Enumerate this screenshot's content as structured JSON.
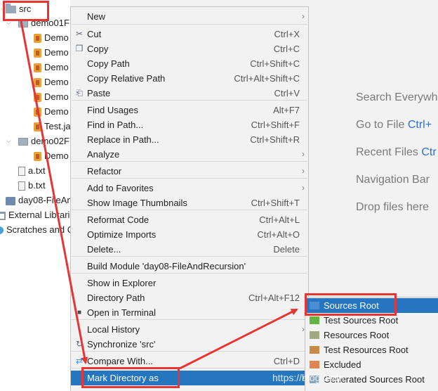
{
  "tree": {
    "nodes": [
      {
        "label": "src",
        "indent": 0,
        "icon": "source-folder-icon",
        "expanded": true
      },
      {
        "label": "demo01F",
        "indent": 1,
        "icon": "package-icon",
        "expanded": true
      },
      {
        "label": "Demo",
        "indent": 2,
        "icon": "java-class-icon"
      },
      {
        "label": "Demo",
        "indent": 2,
        "icon": "java-class-icon"
      },
      {
        "label": "Demo",
        "indent": 2,
        "icon": "java-class-icon"
      },
      {
        "label": "Demo",
        "indent": 2,
        "icon": "java-class-icon"
      },
      {
        "label": "Demo",
        "indent": 2,
        "icon": "java-class-icon"
      },
      {
        "label": "Demo",
        "indent": 2,
        "icon": "java-class-icon"
      },
      {
        "label": "Test.ja",
        "indent": 2,
        "icon": "java-class-icon"
      },
      {
        "label": "demo02F",
        "indent": 1,
        "icon": "package-icon",
        "expanded": true
      },
      {
        "label": "Demo",
        "indent": 2,
        "icon": "java-class-icon"
      },
      {
        "label": "a.txt",
        "indent": 1,
        "icon": "text-file-icon"
      },
      {
        "label": "b.txt",
        "indent": 1,
        "icon": "text-file-icon"
      },
      {
        "label": "day08-FileAn",
        "indent": 0,
        "icon": "module-file-icon"
      },
      {
        "label": "External Librari",
        "indent": -1,
        "icon": "library-icon"
      },
      {
        "label": "Scratches and C",
        "indent": -1,
        "icon": "scratches-icon"
      }
    ]
  },
  "editor_hints": [
    {
      "text": "Search Everywh",
      "shortcut": ""
    },
    {
      "text": "Go to File ",
      "shortcut": "Ctrl+"
    },
    {
      "text": "Recent Files ",
      "shortcut": "Ctr"
    },
    {
      "text": "Navigation Bar",
      "shortcut": ""
    },
    {
      "text": "Drop files here",
      "shortcut": ""
    }
  ],
  "menu": {
    "items": [
      {
        "label": "New",
        "shortcut": "",
        "submenu": true
      },
      {
        "label": "Cut",
        "shortcut": "Ctrl+X",
        "icon": "cut-icon"
      },
      {
        "label": "Copy",
        "shortcut": "Ctrl+C",
        "icon": "copy-icon"
      },
      {
        "label": "Copy Path",
        "shortcut": "Ctrl+Shift+C"
      },
      {
        "label": "Copy Relative Path",
        "shortcut": "Ctrl+Alt+Shift+C"
      },
      {
        "label": "Paste",
        "shortcut": "Ctrl+V",
        "icon": "paste-icon"
      },
      {
        "label": "Find Usages",
        "shortcut": "Alt+F7"
      },
      {
        "label": "Find in Path...",
        "shortcut": "Ctrl+Shift+F"
      },
      {
        "label": "Replace in Path...",
        "shortcut": "Ctrl+Shift+R"
      },
      {
        "label": "Analyze",
        "shortcut": "",
        "submenu": true
      },
      {
        "label": "Refactor",
        "shortcut": "",
        "submenu": true
      },
      {
        "label": "Add to Favorites",
        "shortcut": "",
        "submenu": true
      },
      {
        "label": "Show Image Thumbnails",
        "shortcut": "Ctrl+Shift+T"
      },
      {
        "label": "Reformat Code",
        "shortcut": "Ctrl+Alt+L"
      },
      {
        "label": "Optimize Imports",
        "shortcut": "Ctrl+Alt+O"
      },
      {
        "label": "Delete...",
        "shortcut": "Delete"
      },
      {
        "label": "Build Module 'day08-FileAndRecursion'",
        "shortcut": ""
      },
      {
        "label": "Show in Explorer",
        "shortcut": ""
      },
      {
        "label": "Directory Path",
        "shortcut": "Ctrl+Alt+F12"
      },
      {
        "label": "Open in Terminal",
        "shortcut": "",
        "icon": "terminal-icon"
      },
      {
        "label": "Local History",
        "shortcut": "",
        "submenu": true
      },
      {
        "label": "Synchronize 'src'",
        "shortcut": "",
        "icon": "synchronize-icon"
      },
      {
        "label": "Compare With...",
        "shortcut": "Ctrl+D",
        "icon": "compare-icon"
      },
      {
        "label": "Mark Directory as",
        "shortcut": "",
        "submenu": true,
        "selected": true
      }
    ]
  },
  "submenu": {
    "items": [
      {
        "label": "Sources Root",
        "icon": "sources-root-icon",
        "color": "#4a8fd4",
        "selected": true
      },
      {
        "label": "Test Sources Root",
        "icon": "test-sources-root-icon",
        "color": "#62b543"
      },
      {
        "label": "Resources Root",
        "icon": "resources-root-icon",
        "color": "#a3a882"
      },
      {
        "label": "Test Resources Root",
        "icon": "test-resources-root-icon",
        "color": "#c98a48"
      },
      {
        "label": "Excluded",
        "icon": "excluded-icon",
        "color": "#e08450"
      },
      {
        "label": "Generated Sources Root",
        "icon": "generated-sources-root-icon",
        "color": "#8aa6bf"
      }
    ]
  },
  "watermark": "https://blog.csdn"
}
